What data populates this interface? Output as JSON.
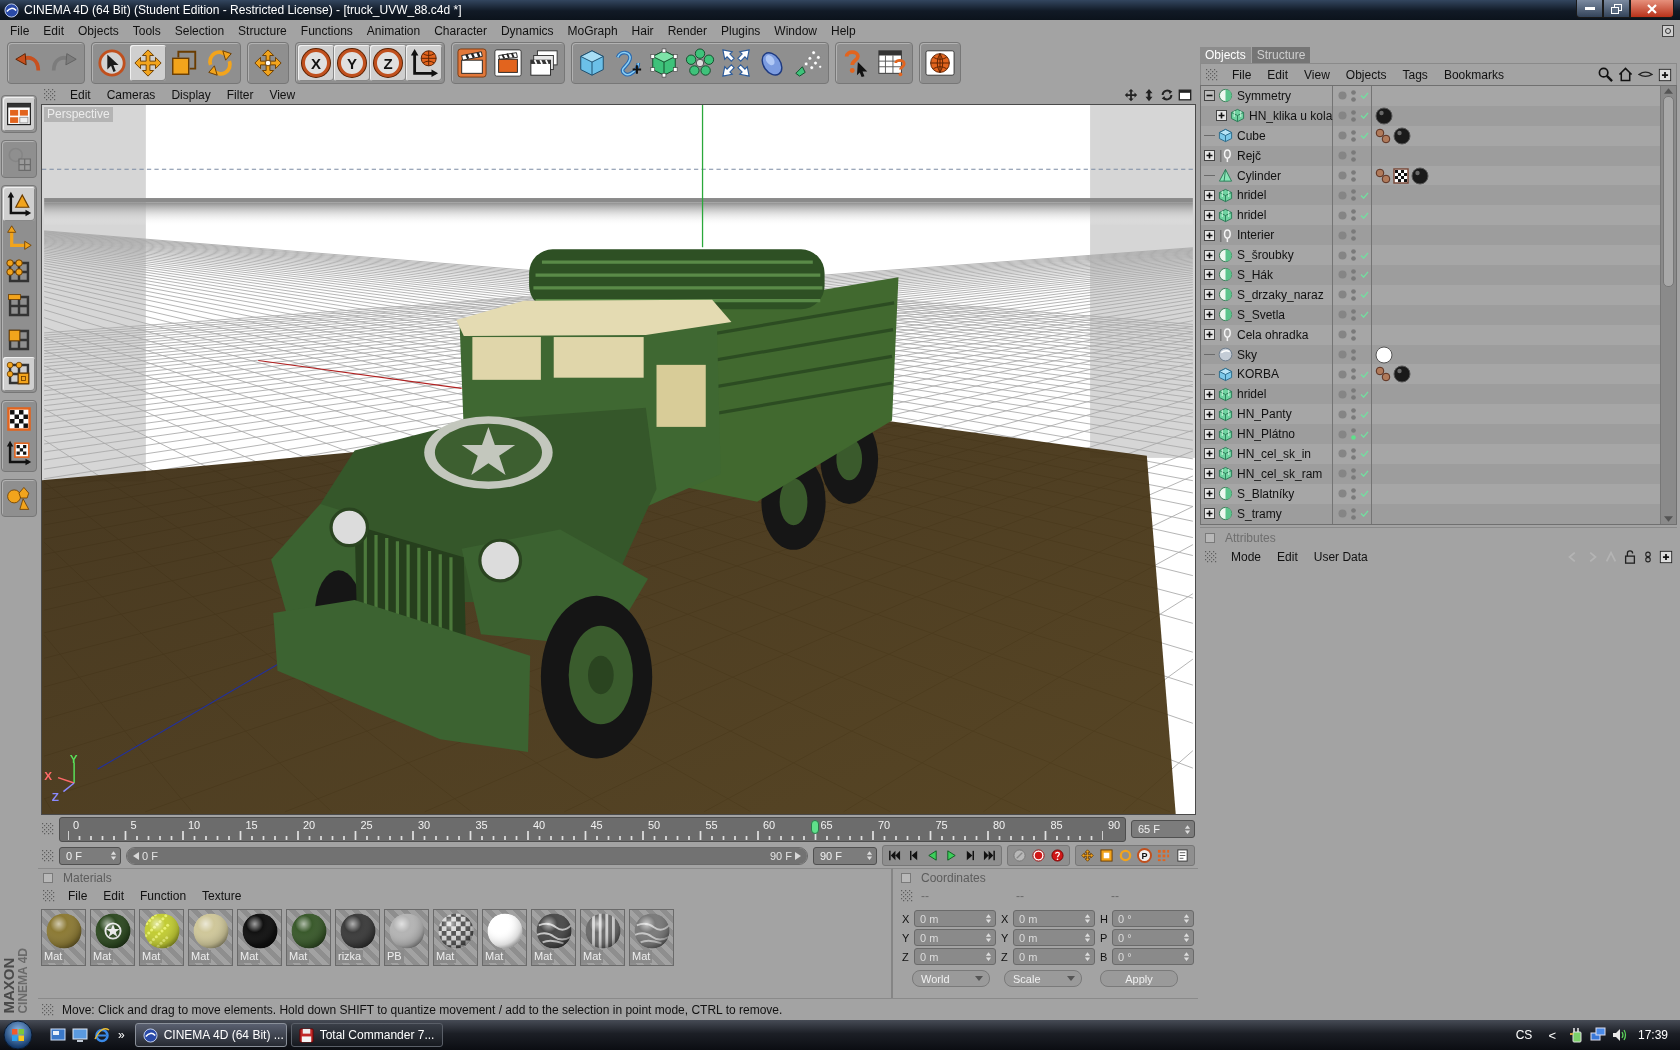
{
  "window": {
    "title": "CINEMA 4D (64 Bit) (Student Edition - Restricted License) - [truck_UVW_88.c4d *]"
  },
  "menu_bar": [
    "File",
    "Edit",
    "Objects",
    "Tools",
    "Selection",
    "Structure",
    "Functions",
    "Animation",
    "Character",
    "Dynamics",
    "MoGraph",
    "Hair",
    "Render",
    "Plugins",
    "Window",
    "Help"
  ],
  "toolbar": {
    "groups": [
      {
        "items": [
          {
            "kind": "undo",
            "selected": false,
            "disabled": false
          },
          {
            "kind": "redo",
            "selected": false,
            "disabled": true
          }
        ]
      },
      {
        "items": [
          {
            "kind": "select",
            "selected": false,
            "disabled": false
          },
          {
            "kind": "move",
            "selected": true,
            "disabled": false
          },
          {
            "kind": "scale",
            "selected": false,
            "disabled": false
          },
          {
            "kind": "rotate",
            "selected": false,
            "disabled": false
          }
        ]
      },
      {
        "items": [
          {
            "kind": "transform",
            "selected": false,
            "disabled": false
          }
        ]
      },
      {
        "items": [
          {
            "kind": "axis",
            "label": "X",
            "selected": true,
            "disabled": false
          },
          {
            "kind": "axis",
            "label": "Y",
            "selected": true,
            "disabled": false
          },
          {
            "kind": "axis",
            "label": "Z",
            "selected": true,
            "disabled": false
          },
          {
            "kind": "coords",
            "selected": true,
            "disabled": false
          }
        ]
      },
      {
        "items": [
          {
            "kind": "render-view",
            "selected": false,
            "disabled": false
          },
          {
            "kind": "render-picture",
            "selected": false,
            "disabled": false
          },
          {
            "kind": "render-settings",
            "selected": false,
            "disabled": false
          }
        ]
      },
      {
        "items": [
          {
            "kind": "cube",
            "selected": false,
            "disabled": false
          },
          {
            "kind": "spline",
            "selected": false,
            "disabled": false
          },
          {
            "kind": "nurbs",
            "selected": false,
            "disabled": false
          },
          {
            "kind": "array",
            "selected": false,
            "disabled": false
          },
          {
            "kind": "deformer",
            "selected": false,
            "disabled": false
          },
          {
            "kind": "scene",
            "selected": false,
            "disabled": false
          },
          {
            "kind": "particles",
            "selected": false,
            "disabled": false
          }
        ]
      },
      {
        "items": [
          {
            "kind": "help",
            "selected": false,
            "disabled": false
          },
          {
            "kind": "table",
            "selected": false,
            "disabled": false
          }
        ]
      },
      {
        "items": [
          {
            "kind": "globe",
            "selected": false,
            "disabled": false
          }
        ]
      }
    ]
  },
  "palette": {
    "groups": [
      {
        "items": [
          {
            "kind": "layout",
            "selected": true,
            "disabled": false
          }
        ]
      },
      {
        "items": [
          {
            "kind": "editable",
            "selected": false,
            "disabled": true
          }
        ]
      },
      {
        "items": [
          {
            "kind": "model",
            "selected": true,
            "disabled": false
          },
          {
            "kind": "axis-mode",
            "selected": false,
            "disabled": false
          },
          {
            "kind": "points",
            "selected": false,
            "disabled": false
          },
          {
            "kind": "edges",
            "selected": false,
            "disabled": false
          },
          {
            "kind": "polygons",
            "selected": false,
            "disabled": false
          },
          {
            "kind": "uv",
            "selected": true,
            "disabled": false
          }
        ]
      },
      {
        "items": [
          {
            "kind": "texture",
            "selected": false,
            "disabled": false
          },
          {
            "kind": "texaxis",
            "selected": false,
            "disabled": false
          }
        ]
      },
      {
        "items": [
          {
            "kind": "sculpt",
            "selected": false,
            "disabled": false
          }
        ]
      }
    ]
  },
  "logo": {
    "brand": "MAXON",
    "product": "CINEMA 4D"
  },
  "viewport": {
    "menu": [
      "Edit",
      "Cameras",
      "Display",
      "Filter",
      "View"
    ],
    "camera": "Perspective",
    "axis_labels": [
      {
        "text": "Y",
        "color": "#5ae05a"
      },
      {
        "text": "X",
        "color": "#ff6a6a"
      },
      {
        "text": "Z",
        "color": "#8a8aff"
      }
    ]
  },
  "timeline": {
    "ticks": [
      "0",
      "5",
      "10",
      "15",
      "20",
      "25",
      "30",
      "35",
      "40",
      "45",
      "50",
      "55",
      "60",
      "65",
      "70",
      "75",
      "80",
      "85",
      "90"
    ],
    "level": 0.7222,
    "frame_field": "65 F",
    "start_field": "0 F",
    "range": {
      "start": "0 F",
      "end": "90 F",
      "level": 1
    },
    "end_field": "90 F",
    "parameter_key": "P"
  },
  "materials": {
    "title": "Materials",
    "menu": [
      "File",
      "Edit",
      "Function",
      "Texture"
    ],
    "items": [
      {
        "name": "Mat",
        "kind": "plain",
        "color": "#8c7a35"
      },
      {
        "name": "Mat",
        "kind": "emblem",
        "color": "#2e4a22"
      },
      {
        "name": "Mat",
        "kind": "speckled",
        "color": "#c2cc34"
      },
      {
        "name": "Mat",
        "kind": "plain",
        "color": "#cfc79a"
      },
      {
        "name": "Mat",
        "kind": "plain",
        "color": "#111111"
      },
      {
        "name": "Mat",
        "kind": "plain",
        "color": "#3a5a2c"
      },
      {
        "name": "rizka",
        "kind": "plain",
        "color": "#3c3c3c"
      },
      {
        "name": "PB",
        "kind": "plain",
        "color": "#b4b4b4"
      },
      {
        "name": "Mat",
        "kind": "checker",
        "color": "#555555"
      },
      {
        "name": "Mat",
        "kind": "plain",
        "color": "#ffffff"
      },
      {
        "name": "Mat",
        "kind": "textured",
        "color": "#4a4a4a"
      },
      {
        "name": "Mat",
        "kind": "striped",
        "color": "#6a6a6a"
      },
      {
        "name": "Mat",
        "kind": "textured",
        "color": "#7a7a7a"
      }
    ]
  },
  "coordinates": {
    "title": "Coordinates",
    "columns": [
      "--",
      "--",
      "--"
    ],
    "disabled": true,
    "fields": [
      {
        "label": "X",
        "value": "0 m"
      },
      {
        "label": "X",
        "value": "0 m"
      },
      {
        "label": "H",
        "value": "0 °"
      },
      {
        "label": "Y",
        "value": "0 m"
      },
      {
        "label": "Y",
        "value": "0 m"
      },
      {
        "label": "P",
        "value": "0 °"
      },
      {
        "label": "Z",
        "value": "0 m"
      },
      {
        "label": "Z",
        "value": "0 m"
      },
      {
        "label": "B",
        "value": "0 °"
      }
    ],
    "dropdowns": [
      "World",
      "Scale"
    ],
    "apply": "Apply"
  },
  "status_bar": "Move: Click and drag to move elements. Hold down SHIFT to quantize movement / add to the selection in point mode, CTRL to remove.",
  "objects": {
    "tabs": [
      {
        "label": "Objects",
        "selected": true
      },
      {
        "label": "Structure",
        "selected": false
      }
    ],
    "menu": [
      "File",
      "Edit",
      "View",
      "Objects",
      "Tags",
      "Bookmarks"
    ],
    "tree": [
      {
        "name": "Symmetry",
        "kind": "symmetry",
        "has_children": true,
        "expanded": true,
        "enabled": true,
        "render_on": false,
        "children": [
          {
            "name": "HN_klika u kola",
            "kind": "hypernurbs",
            "has_children": true,
            "expanded": false,
            "enabled": true,
            "render_on": false,
            "tags": [
              {
                "kind": "material",
                "color": "#1a1a1a"
              }
            ]
          }
        ]
      },
      {
        "name": "Cube",
        "kind": "cube",
        "has_children": false,
        "expanded": false,
        "enabled": true,
        "render_on": false,
        "tags": [
          {
            "kind": "phong"
          },
          {
            "kind": "material",
            "color": "#1a1a1a"
          }
        ]
      },
      {
        "name": "Rejč",
        "kind": "null",
        "has_children": true,
        "expanded": false,
        "enabled": false,
        "render_on": false
      },
      {
        "name": "Cylinder",
        "kind": "cone",
        "has_children": false,
        "expanded": false,
        "enabled": false,
        "render_on": false,
        "tags": [
          {
            "kind": "phong"
          },
          {
            "kind": "uvw"
          },
          {
            "kind": "material",
            "color": "#1a1a1a"
          }
        ]
      },
      {
        "name": "hridel",
        "kind": "hypernurbs",
        "has_children": true,
        "expanded": false,
        "enabled": true,
        "render_on": false
      },
      {
        "name": "hridel",
        "kind": "hypernurbs",
        "has_children": true,
        "expanded": false,
        "enabled": true,
        "render_on": false
      },
      {
        "name": "Interier",
        "kind": "null",
        "has_children": true,
        "expanded": false,
        "enabled": false,
        "render_on": false
      },
      {
        "name": "S_šroubky",
        "kind": "symmetry",
        "has_children": true,
        "expanded": false,
        "enabled": true,
        "render_on": false
      },
      {
        "name": "S_Hák",
        "kind": "symmetry",
        "has_children": true,
        "expanded": false,
        "enabled": true,
        "render_on": false
      },
      {
        "name": "S_drzaky_naraz",
        "kind": "symmetry",
        "has_children": true,
        "expanded": false,
        "enabled": true,
        "render_on": false
      },
      {
        "name": "S_Svetla",
        "kind": "symmetry",
        "has_children": true,
        "expanded": false,
        "enabled": true,
        "render_on": false
      },
      {
        "name": "Cela ohradka",
        "kind": "null",
        "has_children": true,
        "expanded": false,
        "enabled": false,
        "render_on": false
      },
      {
        "name": "Sky",
        "kind": "sky",
        "has_children": false,
        "expanded": false,
        "enabled": false,
        "render_on": false,
        "tags": [
          {
            "kind": "material",
            "color": "#ffffff"
          }
        ]
      },
      {
        "name": "KORBA",
        "kind": "cube",
        "has_children": false,
        "expanded": false,
        "enabled": true,
        "render_on": false,
        "tags": [
          {
            "kind": "phong"
          },
          {
            "kind": "material",
            "color": "#1a1a1a"
          }
        ]
      },
      {
        "name": "hridel",
        "kind": "hypernurbs",
        "has_children": true,
        "expanded": false,
        "enabled": true,
        "render_on": false
      },
      {
        "name": "HN_Panty",
        "kind": "hypernurbs",
        "has_children": true,
        "expanded": false,
        "enabled": true,
        "render_on": false
      },
      {
        "name": "HN_Plátno",
        "kind": "hypernurbs",
        "has_children": true,
        "expanded": false,
        "enabled": true,
        "render_on": true
      },
      {
        "name": "HN_cel_sk_in",
        "kind": "hypernurbs",
        "has_children": true,
        "expanded": false,
        "enabled": true,
        "render_on": false
      },
      {
        "name": "HN_cel_sk_ram",
        "kind": "hypernurbs",
        "has_children": true,
        "expanded": false,
        "enabled": true,
        "render_on": false
      },
      {
        "name": "S_Blatníky",
        "kind": "symmetry",
        "has_children": true,
        "expanded": false,
        "enabled": true,
        "render_on": false
      },
      {
        "name": "S_tramy",
        "kind": "symmetry",
        "has_children": true,
        "expanded": false,
        "enabled": true,
        "render_on": false
      }
    ]
  },
  "attributes": {
    "title": "Attributes",
    "menu": [
      "Mode",
      "Edit",
      "User Data"
    ]
  },
  "taskbar": {
    "quick_launch_more": "»",
    "tasks": [
      {
        "label": "CINEMA 4D (64 Bit) ...",
        "selected": true
      },
      {
        "label": "Total Commander 7...",
        "selected": false
      }
    ],
    "language": "CS",
    "tray_toggle": "<",
    "clock": "17:39"
  }
}
